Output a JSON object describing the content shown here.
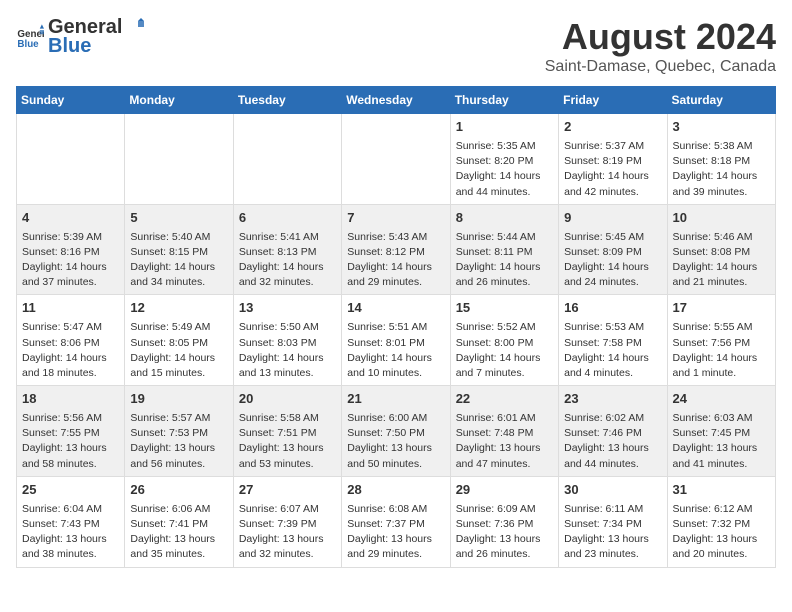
{
  "header": {
    "logo_general": "General",
    "logo_blue": "Blue",
    "title": "August 2024",
    "subtitle": "Saint-Damase, Quebec, Canada"
  },
  "days_of_week": [
    "Sunday",
    "Monday",
    "Tuesday",
    "Wednesday",
    "Thursday",
    "Friday",
    "Saturday"
  ],
  "weeks": [
    {
      "days": [
        {
          "num": "",
          "info": ""
        },
        {
          "num": "",
          "info": ""
        },
        {
          "num": "",
          "info": ""
        },
        {
          "num": "",
          "info": ""
        },
        {
          "num": "1",
          "info": "Sunrise: 5:35 AM\nSunset: 8:20 PM\nDaylight: 14 hours\nand 44 minutes."
        },
        {
          "num": "2",
          "info": "Sunrise: 5:37 AM\nSunset: 8:19 PM\nDaylight: 14 hours\nand 42 minutes."
        },
        {
          "num": "3",
          "info": "Sunrise: 5:38 AM\nSunset: 8:18 PM\nDaylight: 14 hours\nand 39 minutes."
        }
      ]
    },
    {
      "days": [
        {
          "num": "4",
          "info": "Sunrise: 5:39 AM\nSunset: 8:16 PM\nDaylight: 14 hours\nand 37 minutes."
        },
        {
          "num": "5",
          "info": "Sunrise: 5:40 AM\nSunset: 8:15 PM\nDaylight: 14 hours\nand 34 minutes."
        },
        {
          "num": "6",
          "info": "Sunrise: 5:41 AM\nSunset: 8:13 PM\nDaylight: 14 hours\nand 32 minutes."
        },
        {
          "num": "7",
          "info": "Sunrise: 5:43 AM\nSunset: 8:12 PM\nDaylight: 14 hours\nand 29 minutes."
        },
        {
          "num": "8",
          "info": "Sunrise: 5:44 AM\nSunset: 8:11 PM\nDaylight: 14 hours\nand 26 minutes."
        },
        {
          "num": "9",
          "info": "Sunrise: 5:45 AM\nSunset: 8:09 PM\nDaylight: 14 hours\nand 24 minutes."
        },
        {
          "num": "10",
          "info": "Sunrise: 5:46 AM\nSunset: 8:08 PM\nDaylight: 14 hours\nand 21 minutes."
        }
      ]
    },
    {
      "days": [
        {
          "num": "11",
          "info": "Sunrise: 5:47 AM\nSunset: 8:06 PM\nDaylight: 14 hours\nand 18 minutes."
        },
        {
          "num": "12",
          "info": "Sunrise: 5:49 AM\nSunset: 8:05 PM\nDaylight: 14 hours\nand 15 minutes."
        },
        {
          "num": "13",
          "info": "Sunrise: 5:50 AM\nSunset: 8:03 PM\nDaylight: 14 hours\nand 13 minutes."
        },
        {
          "num": "14",
          "info": "Sunrise: 5:51 AM\nSunset: 8:01 PM\nDaylight: 14 hours\nand 10 minutes."
        },
        {
          "num": "15",
          "info": "Sunrise: 5:52 AM\nSunset: 8:00 PM\nDaylight: 14 hours\nand 7 minutes."
        },
        {
          "num": "16",
          "info": "Sunrise: 5:53 AM\nSunset: 7:58 PM\nDaylight: 14 hours\nand 4 minutes."
        },
        {
          "num": "17",
          "info": "Sunrise: 5:55 AM\nSunset: 7:56 PM\nDaylight: 14 hours\nand 1 minute."
        }
      ]
    },
    {
      "days": [
        {
          "num": "18",
          "info": "Sunrise: 5:56 AM\nSunset: 7:55 PM\nDaylight: 13 hours\nand 58 minutes."
        },
        {
          "num": "19",
          "info": "Sunrise: 5:57 AM\nSunset: 7:53 PM\nDaylight: 13 hours\nand 56 minutes."
        },
        {
          "num": "20",
          "info": "Sunrise: 5:58 AM\nSunset: 7:51 PM\nDaylight: 13 hours\nand 53 minutes."
        },
        {
          "num": "21",
          "info": "Sunrise: 6:00 AM\nSunset: 7:50 PM\nDaylight: 13 hours\nand 50 minutes."
        },
        {
          "num": "22",
          "info": "Sunrise: 6:01 AM\nSunset: 7:48 PM\nDaylight: 13 hours\nand 47 minutes."
        },
        {
          "num": "23",
          "info": "Sunrise: 6:02 AM\nSunset: 7:46 PM\nDaylight: 13 hours\nand 44 minutes."
        },
        {
          "num": "24",
          "info": "Sunrise: 6:03 AM\nSunset: 7:45 PM\nDaylight: 13 hours\nand 41 minutes."
        }
      ]
    },
    {
      "days": [
        {
          "num": "25",
          "info": "Sunrise: 6:04 AM\nSunset: 7:43 PM\nDaylight: 13 hours\nand 38 minutes."
        },
        {
          "num": "26",
          "info": "Sunrise: 6:06 AM\nSunset: 7:41 PM\nDaylight: 13 hours\nand 35 minutes."
        },
        {
          "num": "27",
          "info": "Sunrise: 6:07 AM\nSunset: 7:39 PM\nDaylight: 13 hours\nand 32 minutes."
        },
        {
          "num": "28",
          "info": "Sunrise: 6:08 AM\nSunset: 7:37 PM\nDaylight: 13 hours\nand 29 minutes."
        },
        {
          "num": "29",
          "info": "Sunrise: 6:09 AM\nSunset: 7:36 PM\nDaylight: 13 hours\nand 26 minutes."
        },
        {
          "num": "30",
          "info": "Sunrise: 6:11 AM\nSunset: 7:34 PM\nDaylight: 13 hours\nand 23 minutes."
        },
        {
          "num": "31",
          "info": "Sunrise: 6:12 AM\nSunset: 7:32 PM\nDaylight: 13 hours\nand 20 minutes."
        }
      ]
    }
  ]
}
